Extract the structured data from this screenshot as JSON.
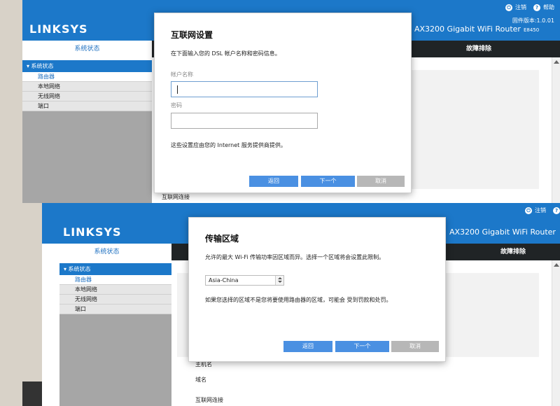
{
  "top_window": {
    "logo": "LINKSYS",
    "logout": "注销",
    "help": "帮助",
    "firmware": "固件版本:1.0.01",
    "model": "AX3200 Gigabit WiFi Router",
    "model_code": "E8450",
    "tab_status": "系统状态",
    "tab_trouble": "故障排除",
    "sidebar_head": "▾ 系统状态",
    "sidebar_items": [
      "路由器",
      "本地网络",
      "无线网络",
      "端口"
    ],
    "content_label": "互联网连接",
    "dialog": {
      "title": "互联网设置",
      "instruction": "在下面输入您的 DSL 帐户名称和密码信息。",
      "account_label": "帐户名称",
      "account_value": "",
      "password_label": "密码",
      "password_value": "",
      "note": "这些设置应由您的 Internet 服务提供商提供。",
      "back": "返回",
      "next": "下一个",
      "cancel": "取消"
    }
  },
  "bottom_window": {
    "logo": "LINKSYS",
    "logout": "注销",
    "model": "AX3200 Gigabit WiFi Router",
    "tab_status": "系统状态",
    "tab_trouble": "故障排除",
    "sidebar_head": "▾ 系统状态",
    "sidebar_items": [
      "路由器",
      "本地网络",
      "无线网络",
      "端口"
    ],
    "content_labels": [
      "主机名",
      "域名",
      "互联网连接"
    ],
    "dialog": {
      "title": "传输区域",
      "instruction": "允许的最大 Wi-Fi 传输功率因区域而异。选择一个区域将会设置此限制。",
      "region_value": "Asia-China",
      "warning": "如果您选择的区域不是您将要使用路由器的区域，可能会    受到罚款和处罚。",
      "back": "返回",
      "next": "下一个",
      "cancel": "取消"
    }
  },
  "colors": {
    "linksys_blue": "#1c78c9",
    "dark_nav": "#202426",
    "button_blue": "#4a90e2",
    "button_grey": "#b7b7b7"
  }
}
